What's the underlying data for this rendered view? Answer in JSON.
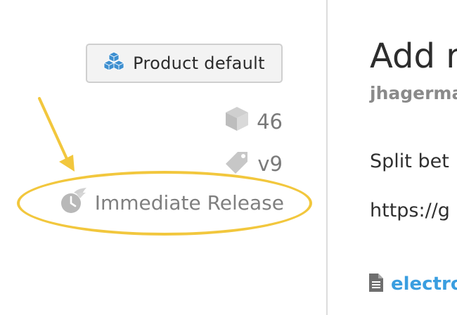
{
  "sidebar": {
    "product_button_label": "Product default",
    "builds_count": "46",
    "version": "v9",
    "release_type": "Immediate Release"
  },
  "main": {
    "title": "Add r",
    "author": "jhagerma",
    "description": "Split bet",
    "url": "https://g",
    "file_link": "electro"
  },
  "colors": {
    "highlight": "#f2c73d",
    "link": "#3a9ee0",
    "product_icon": "#3d8fd0"
  }
}
